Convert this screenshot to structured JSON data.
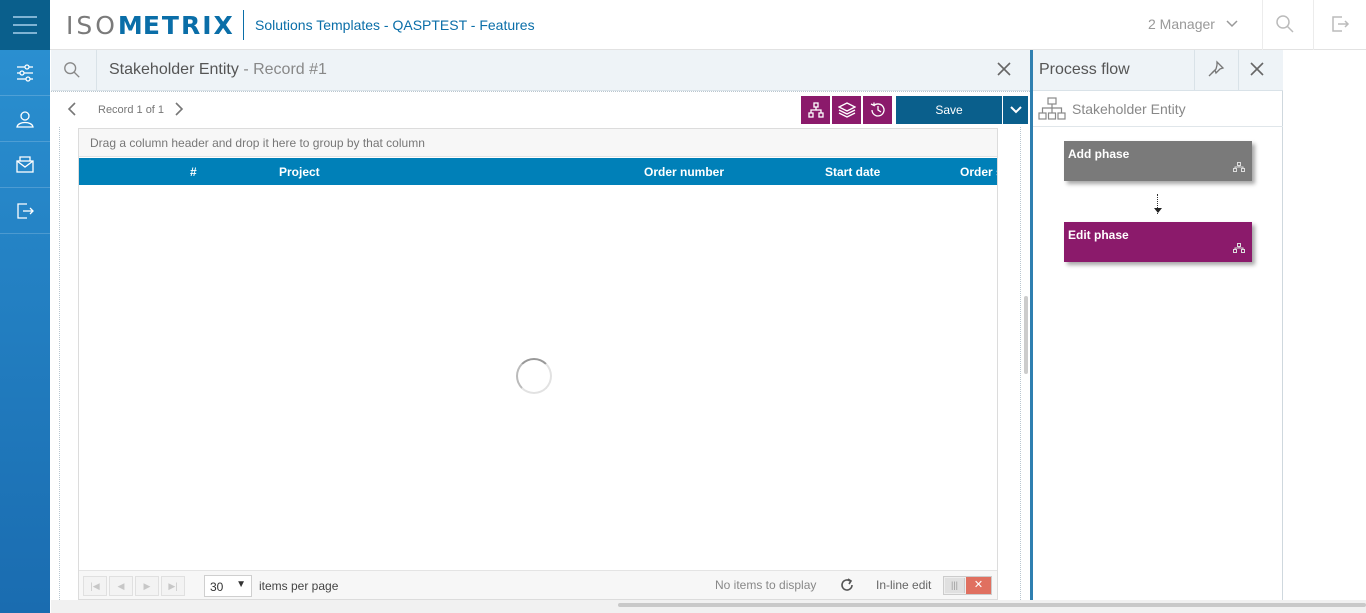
{
  "topbar": {
    "logo_iso": "ISO",
    "logo_m": "M",
    "logo_etrix": "ETRIX",
    "app_title": "Solutions Templates - QASPTEST - Features",
    "user": "2 Manager"
  },
  "sidebar": {
    "items": [
      {
        "icon": "sliders-icon"
      },
      {
        "icon": "user-icon"
      },
      {
        "icon": "mail-icon"
      },
      {
        "icon": "logout-icon"
      }
    ]
  },
  "record": {
    "title": "Stakeholder Entity",
    "subtitle": "- Record #1",
    "count": "Record 1 of 1",
    "save_label": "Save"
  },
  "grid": {
    "group_hint": "Drag a column header and drop it here to group by that column",
    "columns": [
      "#",
      "Project",
      "Order number",
      "Start date",
      "Order s"
    ],
    "page_size": "30",
    "items_per_page": "items per page",
    "no_items": "No items to display",
    "inline_edit": "In-line edit"
  },
  "process_flow": {
    "title": "Process flow",
    "entity": "Stakeholder Entity",
    "phases": [
      {
        "label": "Add phase",
        "color": "#7a7a7a"
      },
      {
        "label": "Edit phase",
        "color": "#8b1a6b"
      }
    ]
  },
  "colors": {
    "accent": "#0a6ea8",
    "header_blue": "#0080b8",
    "purple": "#8b1a6b",
    "save_blue": "#0a5f8c"
  }
}
